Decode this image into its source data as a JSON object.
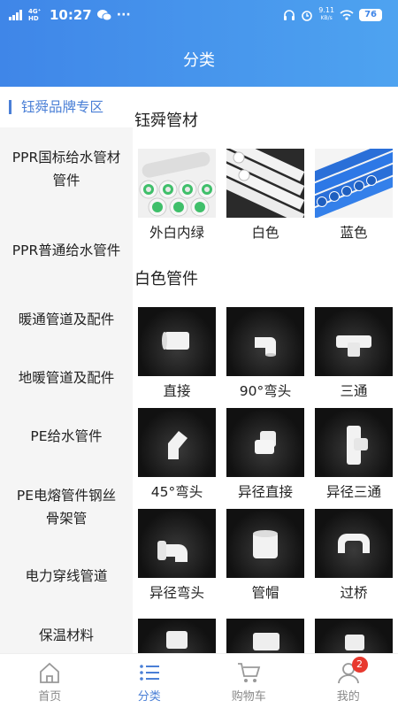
{
  "status_bar": {
    "network": "4G⁺ HD",
    "time": "10:27",
    "speed": "9.11",
    "speed_unit": "KB/s",
    "battery": "76"
  },
  "header": {
    "title": "分类"
  },
  "sidebar": {
    "items": [
      {
        "label": "钰舜品牌专区",
        "active": true
      },
      {
        "label": "PPR国标给水管材管件",
        "active": false
      },
      {
        "label": "PPR普通给水管件",
        "active": false
      },
      {
        "label": "暖通管道及配件",
        "active": false
      },
      {
        "label": "地暖管道及配件",
        "active": false
      },
      {
        "label": "PE给水管件",
        "active": false
      },
      {
        "label": "PE电熔管件钢丝骨架管",
        "active": false
      },
      {
        "label": "电力穿线管道",
        "active": false
      },
      {
        "label": "保温材料",
        "active": false
      }
    ]
  },
  "sections": [
    {
      "title": "钰舜管材",
      "items": [
        {
          "label": "外白内绿",
          "image": "white-pipe-green-inner"
        },
        {
          "label": "白色",
          "image": "white-pipes"
        },
        {
          "label": "蓝色",
          "image": "blue-pipes"
        }
      ]
    },
    {
      "title": "白色管件",
      "items": [
        {
          "label": "直接",
          "image": "straight-coupling"
        },
        {
          "label": "90°弯头",
          "image": "elbow-90"
        },
        {
          "label": "三通",
          "image": "tee"
        },
        {
          "label": "45°弯头",
          "image": "elbow-45"
        },
        {
          "label": "异径直接",
          "image": "reducing-coupling"
        },
        {
          "label": "异径三通",
          "image": "reducing-tee"
        },
        {
          "label": "异径弯头",
          "image": "reducing-elbow"
        },
        {
          "label": "管帽",
          "image": "pipe-cap"
        },
        {
          "label": "过桥",
          "image": "crossover-bend"
        }
      ]
    }
  ],
  "bottom_nav": [
    {
      "label": "首页",
      "icon": "home-icon",
      "active": false
    },
    {
      "label": "分类",
      "icon": "list-icon",
      "active": true
    },
    {
      "label": "购物车",
      "icon": "cart-icon",
      "active": false
    },
    {
      "label": "我的",
      "icon": "user-icon",
      "active": false,
      "badge": "2"
    }
  ],
  "colors": {
    "accent": "#4a7fd6",
    "header": "#4690ec",
    "badge": "#e8392f"
  }
}
